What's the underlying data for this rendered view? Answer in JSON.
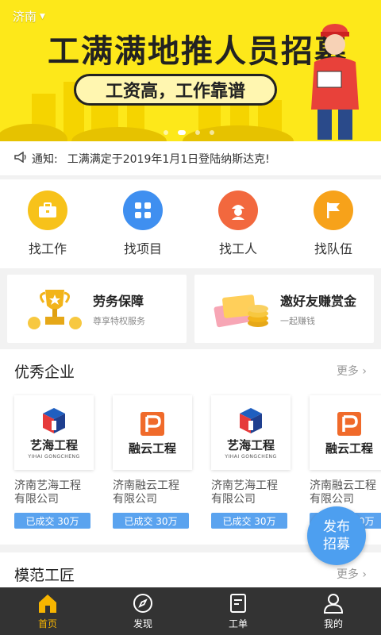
{
  "banner": {
    "city": "济南",
    "title": "工满满地推人员招募",
    "subtitle": "工资高，工作靠谱",
    "dots": 4,
    "active_dot": 1
  },
  "notice": {
    "label": "通知:",
    "text": "工满满定于2019年1月1日登陆纳斯达克!"
  },
  "quicknav": [
    {
      "label": "找工作",
      "icon": "briefcase-icon",
      "color": "#f7c21a"
    },
    {
      "label": "找项目",
      "icon": "grid-icon",
      "color": "#3f8ff0"
    },
    {
      "label": "找工人",
      "icon": "worker-helmet-icon",
      "color": "#f2683e"
    },
    {
      "label": "找队伍",
      "icon": "flag-icon",
      "color": "#f7a21a"
    }
  ],
  "promos": [
    {
      "title": "劳务保障",
      "subtitle": "尊享特权服务",
      "icon": "trophy-icon"
    },
    {
      "title": "邀好友赚赏金",
      "subtitle": "一起赚钱",
      "icon": "coins-icon"
    }
  ],
  "companies_section": {
    "title": "优秀企业",
    "more": "更多",
    "companies": [
      {
        "logo_text": "艺海工程",
        "logo_pinyin": "YIHAI GONGCHENG",
        "name": "济南艺海工程有限公司",
        "badge": "已成交 30万"
      },
      {
        "logo_text": "融云工程",
        "logo_pinyin": "",
        "name": "济南融云工程有限公司",
        "badge": "已成交 30万"
      },
      {
        "logo_text": "艺海工程",
        "logo_pinyin": "YIHAI GONGCHENG",
        "name": "济南艺海工程有限公司",
        "badge": "已成交 30万"
      },
      {
        "logo_text": "融云工程",
        "logo_pinyin": "",
        "name": "济南融云工程有限公司",
        "badge": "已成交 30万"
      }
    ]
  },
  "craftsmen_section": {
    "title": "模范工匠",
    "more": "更多"
  },
  "fab": {
    "line1": "发布",
    "line2": "招募"
  },
  "tabbar": [
    {
      "label": "首页",
      "icon": "home-icon",
      "active": true
    },
    {
      "label": "发现",
      "icon": "compass-icon",
      "active": false
    },
    {
      "label": "工单",
      "icon": "document-icon",
      "active": false
    },
    {
      "label": "我的",
      "icon": "user-icon",
      "active": false
    }
  ],
  "colors": {
    "banner_bg": "#fde81a",
    "accent_blue": "#4d9ff0",
    "tab_active": "#f7b500",
    "tabbar_bg": "#333333"
  }
}
